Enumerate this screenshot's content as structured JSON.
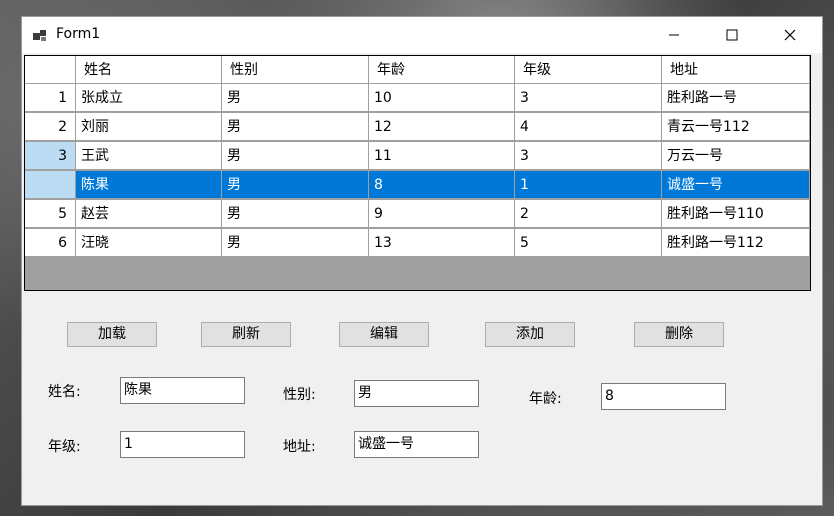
{
  "window": {
    "title": "Form1"
  },
  "grid": {
    "columns": [
      "姓名",
      "性别",
      "年龄",
      "年级",
      "地址"
    ],
    "rows": [
      {
        "num": "1",
        "name": "张成立",
        "gender": "男",
        "age": "10",
        "grade": "3",
        "address": "胜利路一号"
      },
      {
        "num": "2",
        "name": "刘丽",
        "gender": "男",
        "age": "12",
        "grade": "4",
        "address": "青云一号112"
      },
      {
        "num": "3",
        "name": "王武",
        "gender": "男",
        "age": "11",
        "grade": "3",
        "address": "万云一号"
      },
      {
        "num": "",
        "name": "陈果",
        "gender": "男",
        "age": "8",
        "grade": "1",
        "address": "诚盛一号"
      },
      {
        "num": "5",
        "name": "赵芸",
        "gender": "男",
        "age": "9",
        "grade": "2",
        "address": "胜利路一号110"
      },
      {
        "num": "6",
        "name": "汪晓",
        "gender": "男",
        "age": "13",
        "grade": "5",
        "address": "胜利路一号112"
      }
    ]
  },
  "buttons": {
    "load": "加载",
    "refresh": "刷新",
    "edit": "编辑",
    "add": "添加",
    "delete": "删除"
  },
  "form": {
    "name_label": "姓名:",
    "name_value": "陈果",
    "gender_label": "性别:",
    "gender_value": "男",
    "age_label": "年龄:",
    "age_value": "8",
    "grade_label": "年级:",
    "grade_value": "1",
    "address_label": "地址:",
    "address_value": "诚盛一号"
  },
  "colors": {
    "selection": "#0078d7",
    "row_header_current": "#bcdcf4",
    "grid_background": "#a0a0a0"
  },
  "icons": [
    "app-icon",
    "minimize-icon",
    "maximize-icon",
    "close-icon"
  ]
}
